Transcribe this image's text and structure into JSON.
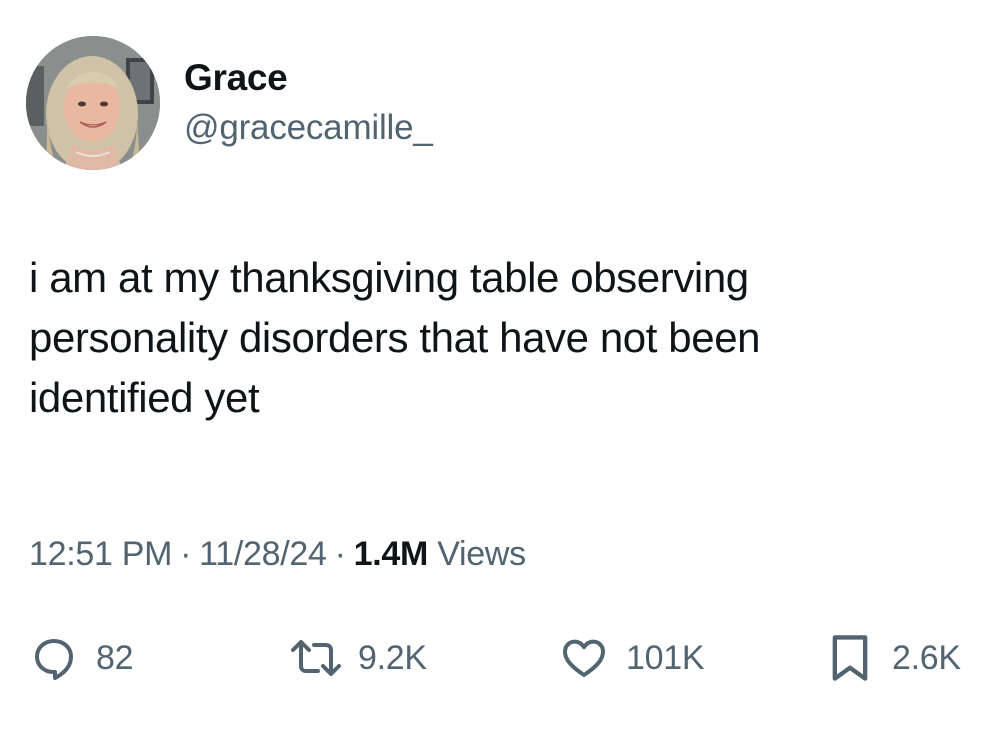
{
  "user": {
    "display_name": "Grace",
    "handle": "@gracecamille_"
  },
  "tweet": {
    "text_lines": [
      "i am at my thanksgiving table observing",
      "personality disorders that have not been",
      "identified yet"
    ]
  },
  "meta": {
    "time": "12:51 PM",
    "separator": "·",
    "date": "11/28/24",
    "views_count": "1.4M",
    "views_label": "Views"
  },
  "actions": {
    "replies": "82",
    "reposts": "9.2K",
    "likes": "101K",
    "bookmarks": "2.6K"
  },
  "icons": {
    "reply": "reply-icon",
    "repost": "repost-icon",
    "like": "heart-icon",
    "bookmark": "bookmark-icon"
  },
  "colors": {
    "text_primary": "#0f1419",
    "text_secondary": "#536471",
    "background": "#ffffff"
  }
}
